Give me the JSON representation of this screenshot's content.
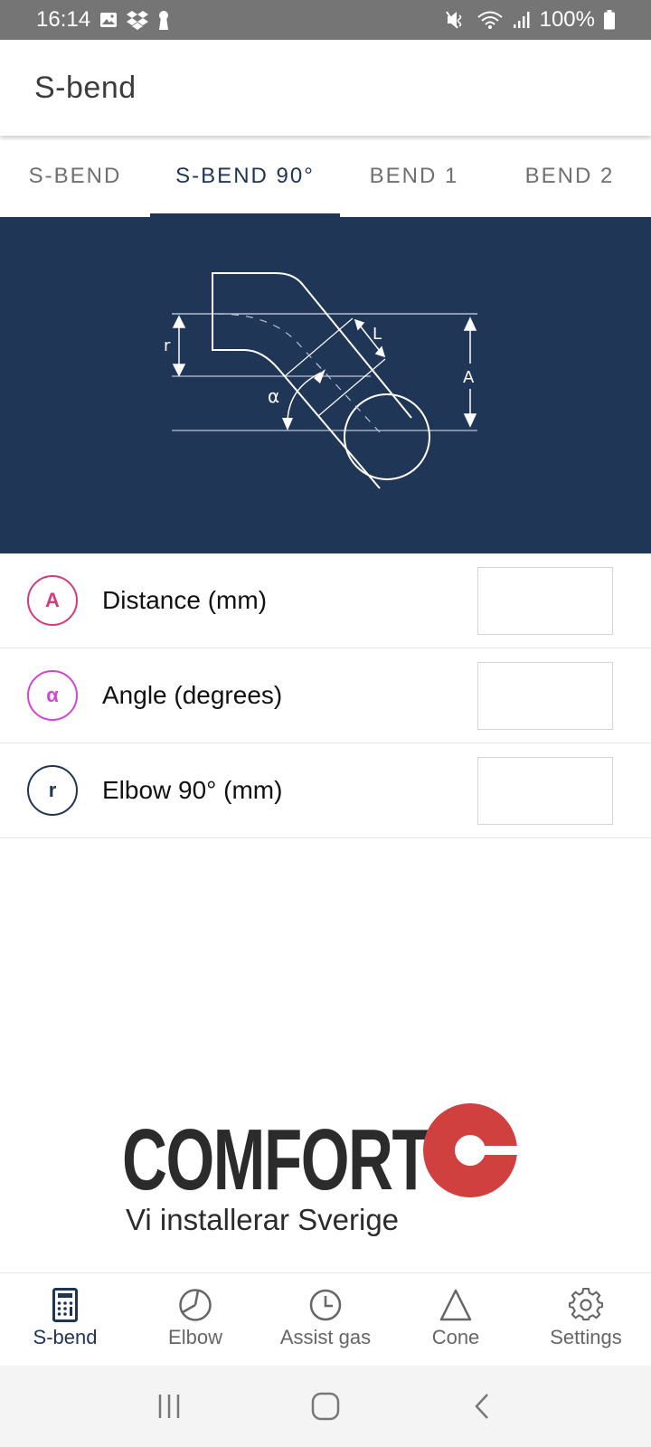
{
  "status_bar": {
    "time": "16:14",
    "battery": "100%",
    "left_icons": [
      "gallery-icon",
      "dropbox-icon",
      "keyhole-icon"
    ],
    "right_icons": [
      "mute-icon",
      "wifi-icon",
      "signal-icon",
      "battery-icon"
    ]
  },
  "app_bar": {
    "title": "S-bend"
  },
  "tabs": [
    {
      "label": "S-BEND",
      "active": false
    },
    {
      "label": "S-BEND 90°",
      "active": true
    },
    {
      "label": "BEND 1",
      "active": false
    },
    {
      "label": "BEND 2",
      "active": false
    }
  ],
  "diagram": {
    "labels": {
      "r": "r",
      "L": "L",
      "A": "A",
      "alpha": "α"
    }
  },
  "inputs": [
    {
      "badge": "A",
      "badge_color": "#d63a7c",
      "label": "Distance (mm)",
      "value": "",
      "placeholder": ""
    },
    {
      "badge": "α",
      "badge_color": "#d444d4",
      "label": "Angle (degrees)",
      "value": "",
      "placeholder": ""
    },
    {
      "badge": "r",
      "badge_color": "#1f3556",
      "label": "Elbow 90° (mm)",
      "value": "",
      "placeholder": ""
    }
  ],
  "logo": {
    "word": "COMFORT",
    "tagline": "Vi installerar Sverige",
    "mark_color": "#d0403e"
  },
  "bottom_nav": [
    {
      "label": "S-bend",
      "icon": "calculator-icon",
      "active": true
    },
    {
      "label": "Elbow",
      "icon": "pie-chart-icon",
      "active": false
    },
    {
      "label": "Assist gas",
      "icon": "clock-icon",
      "active": false
    },
    {
      "label": "Cone",
      "icon": "triangle-icon",
      "active": false
    },
    {
      "label": "Settings",
      "icon": "gear-icon",
      "active": false
    }
  ],
  "colors": {
    "primary": "#1f3556",
    "inactive": "#707070"
  }
}
